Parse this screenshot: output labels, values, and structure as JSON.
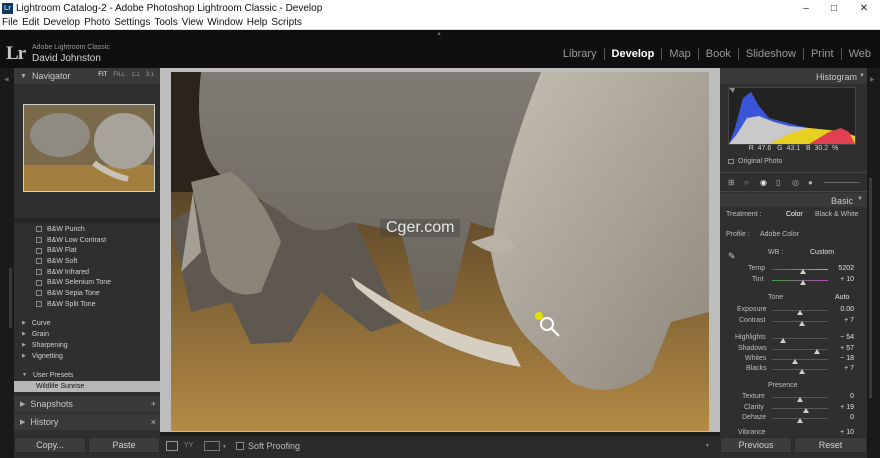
{
  "window": {
    "title": "Lightroom Catalog-2 - Adobe Photoshop Lightroom Classic - Develop"
  },
  "menu": [
    "File",
    "Edit",
    "Develop",
    "Photo",
    "Settings",
    "Tools",
    "View",
    "Window",
    "Help",
    "Scripts"
  ],
  "identity": {
    "logo": "Lr",
    "product": "Adobe Lightroom Classic",
    "user": "David Johnston"
  },
  "modules": [
    "Library",
    "Develop",
    "Map",
    "Book",
    "Slideshow",
    "Print",
    "Web"
  ],
  "active_module": "Develop",
  "left": {
    "navigator": {
      "title": "Navigator",
      "options": [
        "FIT",
        "FILL",
        "1:1",
        "3:1"
      ],
      "selected": "FIT"
    },
    "presets": [
      "B&W Punch",
      "B&W Low Contrast",
      "B&W Flat",
      "B&W Soft",
      "B&W Infrared",
      "B&W Selenium Tone",
      "B&W Sepia Tone",
      "B&W Split Tone"
    ],
    "groups": [
      "Curve",
      "Grain",
      "Sharpening",
      "Vignetting"
    ],
    "user_presets": "User Presets",
    "selected_preset": "Wildlife Sunrise",
    "snapshots": "Snapshots",
    "history": "History",
    "copy_label": "Copy...",
    "paste_label": "Paste"
  },
  "toolbar": {
    "soft_proofing": "Soft Proofing"
  },
  "watermark": "Cger.com",
  "right": {
    "histogram_title": "Histogram",
    "readout": {
      "r_label": "R",
      "r": "47.6",
      "g_label": "G",
      "g": "43.1",
      "b_label": "B",
      "b": "30.2",
      "unit": "%"
    },
    "original_photo": "Original Photo",
    "basic_title": "Basic",
    "treatment_label": "Treatment :",
    "treatment_color": "Color",
    "treatment_bw": "Black & White",
    "profile_label": "Profile :",
    "profile_value": "Adobe Color",
    "wb_label": "WB :",
    "wb_value": "Custom",
    "temp": {
      "label": "Temp",
      "value": "5202"
    },
    "tint": {
      "label": "Tint",
      "value": "+ 10"
    },
    "tone_label": "Tone",
    "auto_label": "Auto",
    "exposure": {
      "label": "Exposure",
      "value": "0.00"
    },
    "contrast": {
      "label": "Contrast",
      "value": "+ 7"
    },
    "highlights": {
      "label": "Highlights",
      "value": "− 54"
    },
    "shadows": {
      "label": "Shadows",
      "value": "+ 57"
    },
    "whites": {
      "label": "Whites",
      "value": "− 18"
    },
    "blacks": {
      "label": "Blacks",
      "value": "+ 7"
    },
    "presence_label": "Presence",
    "texture": {
      "label": "Texture",
      "value": "0"
    },
    "clarity": {
      "label": "Clarity",
      "value": "+ 19"
    },
    "dehaze": {
      "label": "Dehaze",
      "value": "0"
    },
    "vibrance": {
      "label": "Vibrance",
      "value": "+ 10"
    },
    "previous_label": "Previous",
    "reset_label": "Reset"
  },
  "colors": {
    "panel": "#2f2f2f",
    "header": "#393939",
    "idplate": "#0f0f0f",
    "center_bg": "#bdbdbd"
  }
}
